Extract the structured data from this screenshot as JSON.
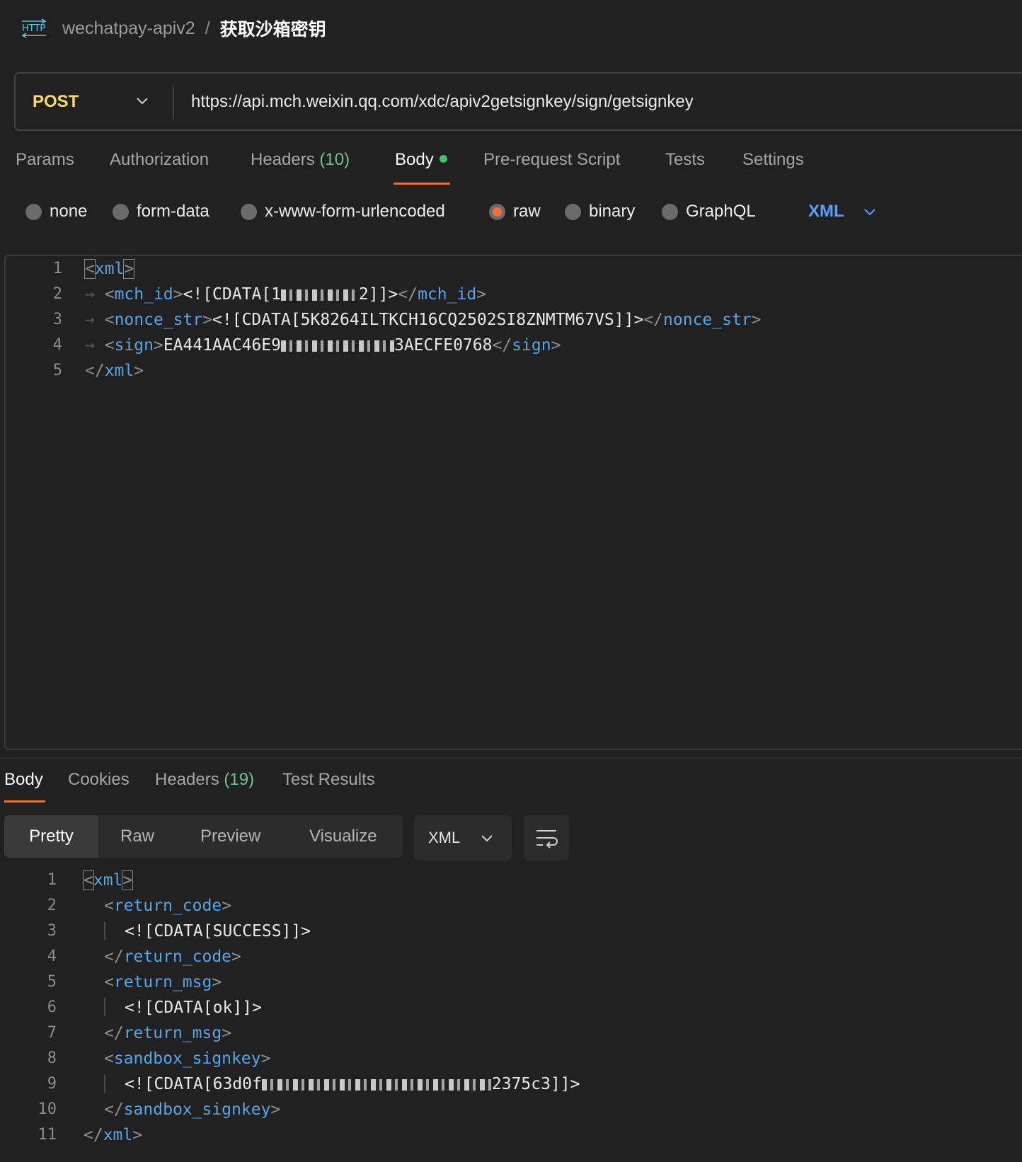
{
  "header": {
    "icon": "http-icon",
    "collection": "wechatpay-apiv2",
    "separator": "/",
    "request_name": "获取沙箱密钥"
  },
  "url_bar": {
    "method": "POST",
    "url": "https://api.mch.weixin.qq.com/xdc/apiv2getsignkey/sign/getsignkey"
  },
  "request_tabs": {
    "params": "Params",
    "authorization": "Authorization",
    "headers": "Headers",
    "headers_count": "(10)",
    "body": "Body",
    "pre_request": "Pre-request Script",
    "tests": "Tests",
    "settings": "Settings"
  },
  "body_types": {
    "none": "none",
    "form_data": "form-data",
    "urlencoded": "x-www-form-urlencoded",
    "raw": "raw",
    "binary": "binary",
    "graphql": "GraphQL",
    "language": "XML",
    "selected": "raw"
  },
  "request_body": {
    "line_numbers": [
      "1",
      "2",
      "3",
      "4",
      "5"
    ],
    "l1_tag": "xml",
    "l2_open": "mch_id",
    "l2_value_start": "<![CDATA[1",
    "l2_value_end": "2]]>",
    "l2_close": "mch_id",
    "l3_open": "nonce_str",
    "l3_value": "<![CDATA[5K8264ILTKCH16CQ2502SI8ZNMTM67VS]]>",
    "l3_close": "nonce_str",
    "l4_open": "sign",
    "l4_value_start": "EA441AAC46E9",
    "l4_value_end": "3AECFE0768",
    "l4_close": "sign",
    "l5_close": "xml"
  },
  "response_tabs": {
    "body": "Body",
    "cookies": "Cookies",
    "headers": "Headers",
    "headers_count": "(19)",
    "test_results": "Test Results"
  },
  "response_view": {
    "pretty": "Pretty",
    "raw": "Raw",
    "preview": "Preview",
    "visualize": "Visualize",
    "format": "XML"
  },
  "response_body": {
    "line_numbers": [
      "1",
      "2",
      "3",
      "4",
      "5",
      "6",
      "7",
      "8",
      "9",
      "10",
      "11"
    ],
    "xml": "xml",
    "return_code": "return_code",
    "return_code_value": "<![CDATA[SUCCESS]]>",
    "return_msg": "return_msg",
    "return_msg_value": "<![CDATA[ok]]>",
    "sandbox_signkey": "sandbox_signkey",
    "signkey_value_start": "<![CDATA[63d0f",
    "signkey_value_end": "2375c3]]>"
  },
  "colors": {
    "accent": "#ff6c37",
    "method": "#ffd86b",
    "tag": "#5ba4e6",
    "count": "#6fc58c",
    "language": "#5aa2ff"
  }
}
